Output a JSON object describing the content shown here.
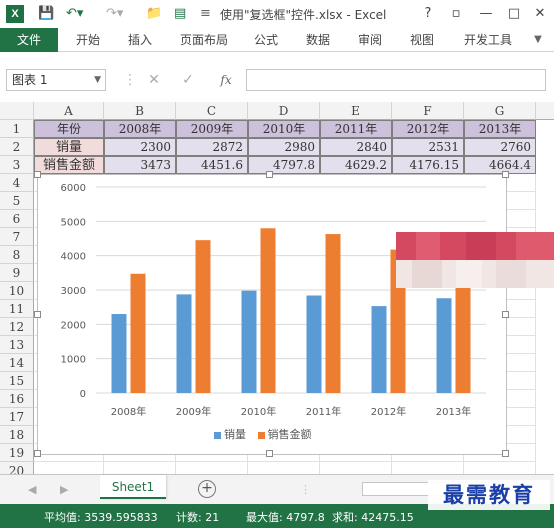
{
  "window": {
    "title": "使用\"复选框\"控件.xlsx - Excel",
    "help": "?",
    "minimize": "—",
    "restore": "▫",
    "close": "✕"
  },
  "ribbon": {
    "tabs": [
      "文件",
      "开始",
      "插入",
      "页面布局",
      "公式",
      "数据",
      "审阅",
      "视图",
      "开发工具"
    ]
  },
  "formula_bar": {
    "name_box": "图表 1",
    "fx": "fx",
    "value": ""
  },
  "sheet": {
    "columns": [
      "A",
      "B",
      "C",
      "D",
      "E",
      "F",
      "G"
    ],
    "rows": [
      "1",
      "2",
      "3",
      "4",
      "5",
      "6",
      "7",
      "8",
      "9",
      "10",
      "11",
      "12",
      "13",
      "14",
      "15",
      "16",
      "17",
      "18",
      "19",
      "20"
    ],
    "table": {
      "header": [
        "年份",
        "2008年",
        "2009年",
        "2010年",
        "2011年",
        "2012年",
        "2013年"
      ],
      "row2": [
        "销量",
        "2300",
        "2872",
        "2980",
        "2840",
        "2531",
        "2760"
      ],
      "row3": [
        "销售金额",
        "3473",
        "4451.6",
        "4797.8",
        "4629.2",
        "4176.15",
        "4664.4"
      ]
    }
  },
  "chart_data": {
    "type": "bar",
    "categories": [
      "2008年",
      "2009年",
      "2010年",
      "2011年",
      "2012年",
      "2013年"
    ],
    "series": [
      {
        "name": "销量",
        "color": "#5b9bd5",
        "values": [
          2300,
          2872,
          2980,
          2840,
          2531,
          2760
        ]
      },
      {
        "name": "销售金额",
        "color": "#ed7d31",
        "values": [
          3473,
          4451.6,
          4797.8,
          4629.2,
          4176.15,
          4664.4
        ]
      }
    ],
    "yticks": [
      "0",
      "1000",
      "2000",
      "3000",
      "4000",
      "5000",
      "6000"
    ],
    "ylim": [
      0,
      6000
    ],
    "grid": true,
    "legend": "bottom"
  },
  "sheet_tabs": {
    "active": "Sheet1",
    "add": "+"
  },
  "status": {
    "average": "平均值: 3539.595833",
    "count": "计数: 21",
    "max": "最大值: 4797.8",
    "sum": "求和: 42475.15"
  },
  "watermark": "最需教育"
}
